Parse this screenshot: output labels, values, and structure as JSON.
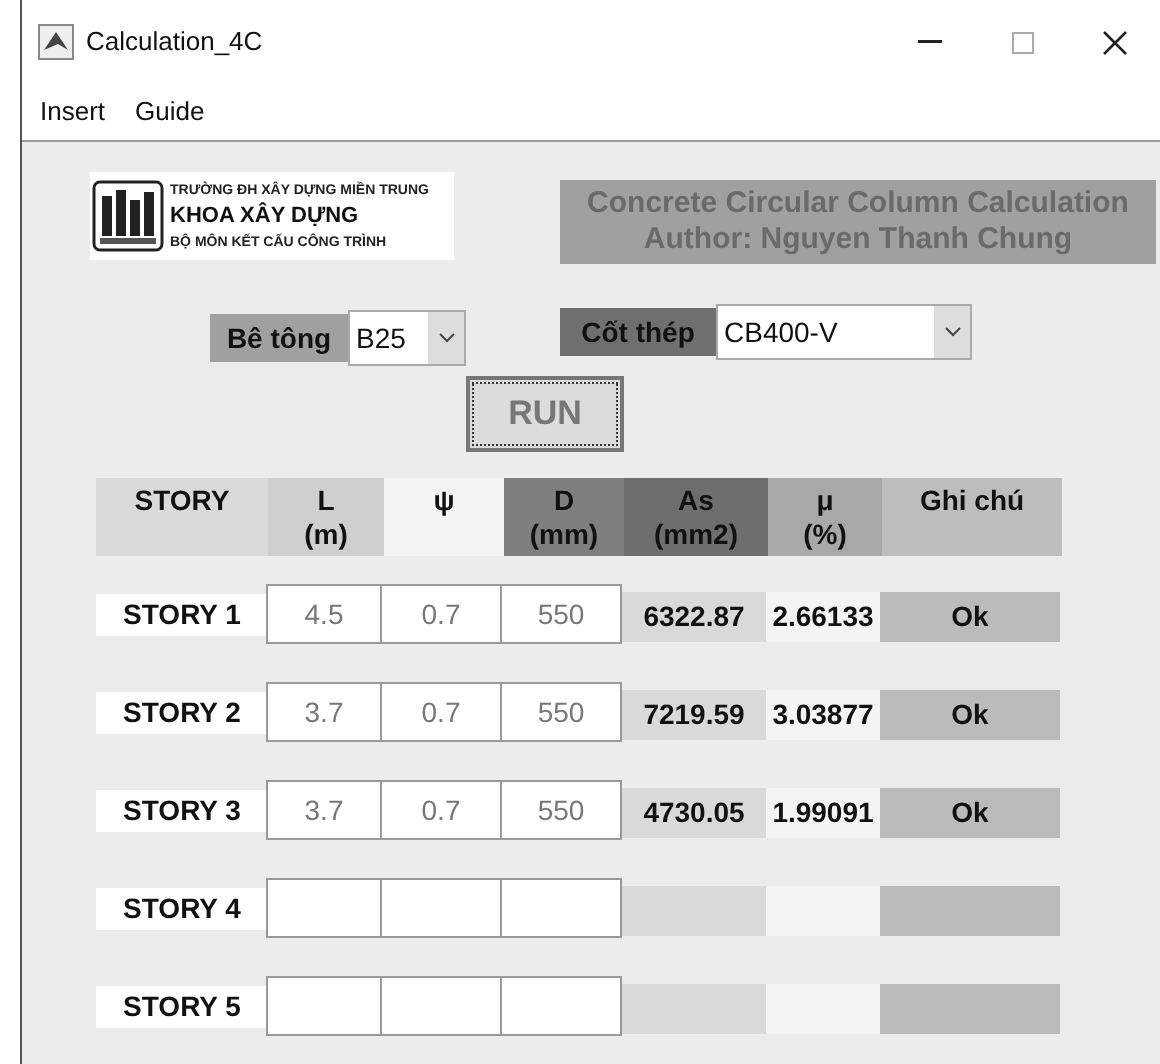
{
  "window": {
    "title": "Calculation_4C"
  },
  "menu": [
    "Insert",
    "Guide"
  ],
  "logo": {
    "lines": [
      "TRƯỜNG ĐH XÂY DỰNG MIỀN TRUNG",
      "KHOA XÂY DỰNG",
      "BỘ MÔN KẾT CẤU CÔNG TRÌNH"
    ]
  },
  "banner": [
    "Concrete Circular Column Calculation",
    "Author: Nguyen Thanh Chung"
  ],
  "concrete": {
    "label": "Bê tông",
    "value": "B25"
  },
  "steel": {
    "label": "Cốt thép",
    "value": "CB400-V"
  },
  "run_button": "RUN",
  "table": {
    "columns": [
      [
        "STORY"
      ],
      [
        "L",
        "(m)"
      ],
      [
        "ψ"
      ],
      [
        "D",
        "(mm)"
      ],
      [
        "As",
        "(mm2)"
      ],
      [
        "μ",
        "(%)"
      ],
      [
        "Ghi chú"
      ]
    ],
    "rows": [
      {
        "story": "STORY 1",
        "L": "4.5",
        "psi": "0.7",
        "D": "550",
        "As": "6322.87",
        "mu": "2.66133",
        "note": "Ok"
      },
      {
        "story": "STORY 2",
        "L": "3.7",
        "psi": "0.7",
        "D": "550",
        "As": "7219.59",
        "mu": "3.03877",
        "note": "Ok"
      },
      {
        "story": "STORY 3",
        "L": "3.7",
        "psi": "0.7",
        "D": "550",
        "As": "4730.05",
        "mu": "1.99091",
        "note": "Ok"
      },
      {
        "story": "STORY 4"
      },
      {
        "story": "STORY 5"
      }
    ]
  }
}
